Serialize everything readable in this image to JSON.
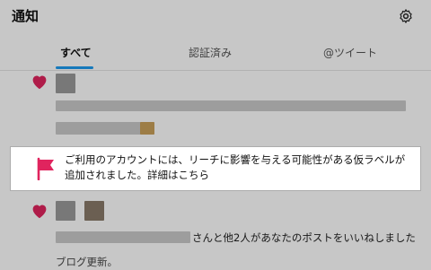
{
  "header": {
    "title": "通知",
    "settings_icon": "gear-icon"
  },
  "tabs": [
    {
      "label": "すべて",
      "active": true
    },
    {
      "label": "認証済み",
      "active": false
    },
    {
      "label": "@ツイート",
      "active": false
    }
  ],
  "highlight": {
    "icon": "flag-icon",
    "color": "#e0245e",
    "line1": "ご利用のアカウントには、リーチに影響を与える可能性がある仮ラベルが",
    "line2": "追加されました。詳細はこちら"
  },
  "notification2": {
    "icon": "heart-icon",
    "suffix_text": "さんと他2人があなたのポストをいいねしました",
    "post_text": "ブログ更新。"
  },
  "colors": {
    "accent": "#1d9bf0",
    "heart": "#e0245e"
  }
}
